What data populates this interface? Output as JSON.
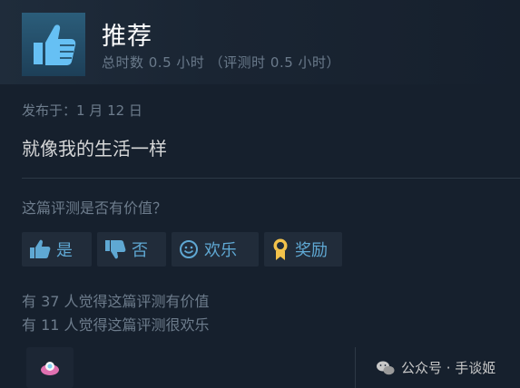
{
  "review": {
    "verdict": "推荐",
    "playtime": "总时数 0.5 小时 （评测时 0.5 小时）",
    "posted": "发布于：1 月 12 日",
    "text": "就像我的生活一样"
  },
  "helpful": {
    "question": "这篇评测是否有价值？",
    "yes_label": "是",
    "no_label": "否",
    "funny_label": "欢乐",
    "award_label": "奖励"
  },
  "stats": {
    "helpful_count": "有 37 人觉得这篇评测有价值",
    "funny_count": "有 11 人觉得这篇评测很欢乐"
  },
  "watermark": {
    "text": "公众号 · 手谈姬"
  },
  "icons": {
    "verdict": "thumbs-up-icon",
    "yes": "thumbs-up-icon",
    "no": "thumbs-down-icon",
    "funny": "smiley-icon",
    "award": "award-medal-icon",
    "watermark": "wechat-icon"
  },
  "colors": {
    "background": "#16202d",
    "button_bg": "#212c3a",
    "button_text": "#5fa8d3",
    "muted_text": "#6d7c8c",
    "thumb_blue": "#66c0f4",
    "award_gold": "#f2c24b"
  }
}
